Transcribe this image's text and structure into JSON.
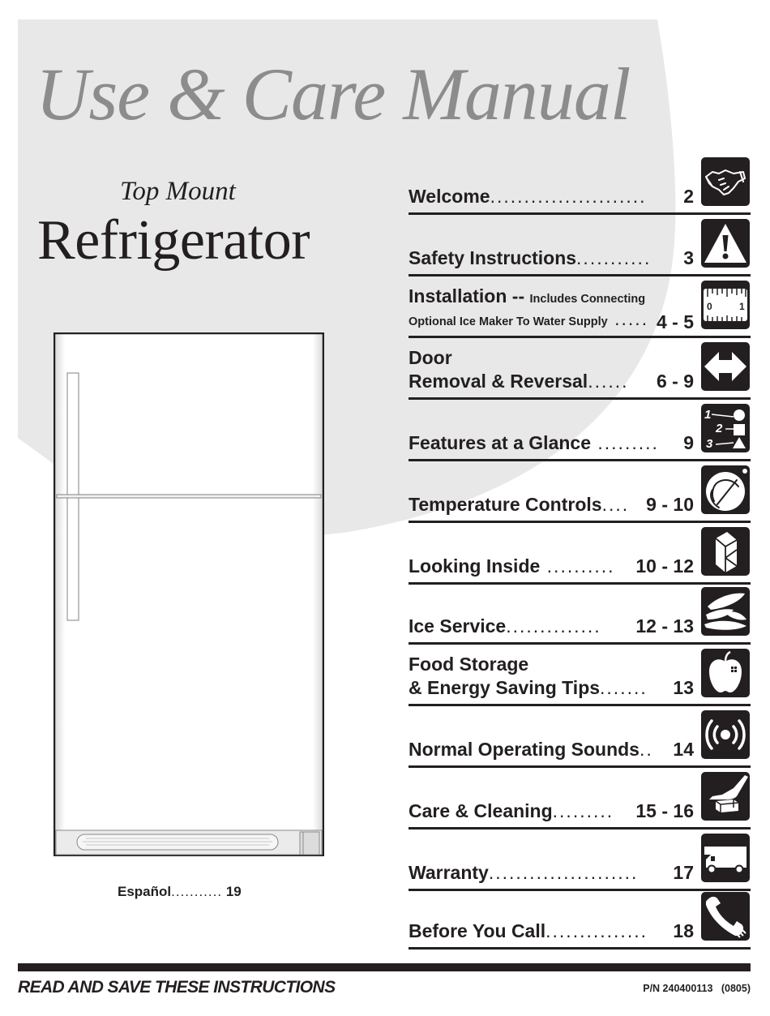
{
  "cover": {
    "manual_title": "Use & Care Manual",
    "subtitle": "Top Mount",
    "product_title": "Refrigerator"
  },
  "espanol": {
    "label": "Español",
    "dots": "...........",
    "page": "19"
  },
  "toc": [
    {
      "title": "Welcome",
      "dots": ".......................",
      "page": "2",
      "icon": "handshake-icon"
    },
    {
      "title": "Safety Instructions",
      "dots": "...........",
      "page": "3",
      "icon": "warning-icon"
    },
    {
      "title": "Installation -- ",
      "note": "Includes Connecting",
      "line2": "Optional Ice Maker To Water Supply",
      "dots": " .....",
      "page": "4 - 5",
      "icon": "ruler-icon"
    },
    {
      "title": "Door",
      "line2": "Removal & Reversal",
      "dots": "......",
      "page": "6 - 9",
      "icon": "double-arrow-icon"
    },
    {
      "title": "Features at a Glance",
      "dots": " .........",
      "page": "9",
      "icon": "numbered-shapes-icon"
    },
    {
      "title": "Temperature Controls",
      "dots": "....",
      "page": "9 - 10",
      "icon": "dial-hand-icon"
    },
    {
      "title": "Looking Inside",
      "dots": " ..........",
      "page": "10 - 12",
      "icon": "shelving-icon"
    },
    {
      "title": "Ice Service",
      "dots": "..............",
      "page": "12 - 13",
      "icon": "ice-cubes-icon"
    },
    {
      "title": "Food Storage",
      "line2": "& Energy Saving Tips",
      "dots": ".......",
      "page": "13",
      "icon": "apple-icon"
    },
    {
      "title": "Normal Operating Sounds",
      "dots": "..",
      "page": "14",
      "icon": "sound-waves-icon"
    },
    {
      "title": "Care & Cleaning",
      "dots": ".........",
      "page": "15 - 16",
      "icon": "cleaning-hand-icon"
    },
    {
      "title": "Warranty",
      "dots": "......................",
      "page": "17",
      "icon": "service-truck-icon"
    },
    {
      "title": "Before You Call",
      "dots": "...............",
      "page": "18",
      "icon": "phone-icon"
    }
  ],
  "footer": {
    "instruction": "READ AND SAVE THESE INSTRUCTIONS",
    "part_number": "P/N 240400113   (0805)"
  },
  "colors": {
    "background_shape": "#e8e8e8",
    "title_gray": "#8c8c8c",
    "ink": "#231f20"
  }
}
